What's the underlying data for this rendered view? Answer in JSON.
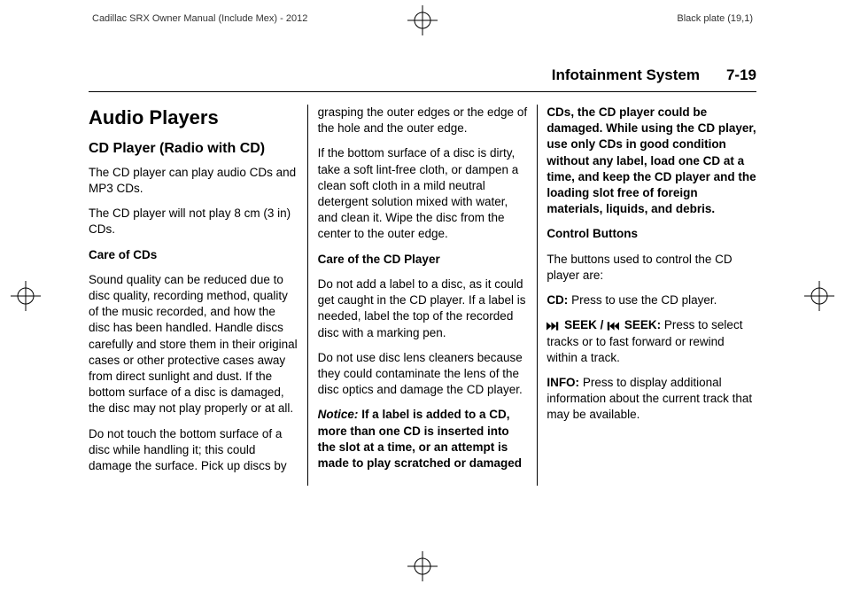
{
  "print": {
    "leftHeader": "Cadillac SRX Owner Manual (Include Mex) - 2012",
    "rightHeader": "Black plate (19,1)"
  },
  "running": {
    "section": "Infotainment System",
    "pageNum": "7-19"
  },
  "body": {
    "h1": "Audio Players",
    "h2": "CD Player (Radio with CD)",
    "p1": "The CD player can play audio CDs and MP3 CDs.",
    "p2": "The CD player will not play 8 cm (3 in) CDs.",
    "sub1": "Care of CDs",
    "p3": "Sound quality can be reduced due to disc quality, recording method, quality of the music recorded, and how the disc has been handled. Handle discs carefully and store them in their original cases or other protective cases away from direct sunlight and dust. If the bottom surface of a disc is damaged, the disc may not play properly or at all.",
    "p4": "Do not touch the bottom surface of a disc while handling it; this could damage the surface. Pick up discs by grasping the outer edges or the edge of the hole and the outer edge.",
    "p5": "If the bottom surface of a disc is dirty, take a soft lint-free cloth, or dampen a clean soft cloth in a mild neutral detergent solution mixed with water, and clean it. Wipe the disc from the center to the outer edge.",
    "sub2": "Care of the CD Player",
    "p6": "Do not add a label to a disc, as it could get caught in the CD player. If a label is needed, label the top of the recorded disc with a marking pen.",
    "p7": "Do not use disc lens cleaners because they could contaminate the lens of the disc optics and damage the CD player.",
    "noticeLabel": "Notice:",
    "notice": "If a label is added to a CD, more than one CD is inserted into the slot at a time, or an attempt is made to play scratched or damaged CDs, the CD player could be damaged. While using the CD player, use only CDs in good condition without any label, load one CD at a time, and keep the CD player and the loading slot free of foreign materials, liquids, and debris.",
    "sub3": "Control Buttons",
    "p8": "The buttons used to control the CD player are:",
    "cdLabel": "CD:",
    "cdText": "Press to use the CD player.",
    "seekLabel": "SEEK /",
    "seekLabel2": "SEEK:",
    "seekText": "Press to select tracks or to fast forward or rewind within a track.",
    "infoLabel": "INFO:",
    "infoText": "Press to display additional information about the current track that may be available."
  }
}
